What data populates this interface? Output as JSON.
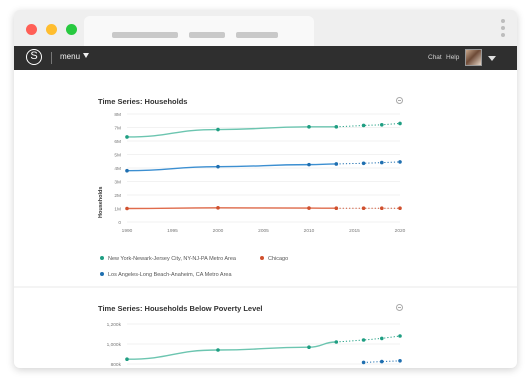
{
  "window": {
    "controls": [
      "close",
      "minimize",
      "maximize"
    ]
  },
  "appbar": {
    "logo_icon": "S",
    "menu_label": "menu",
    "chat_label": "Chat",
    "help_label": "Help"
  },
  "colors": {
    "teal": "#6cc5b0",
    "teal_dot": "#1f9e82",
    "blue": "#3c8fd1",
    "blue_dot": "#1f6fb0",
    "red": "#e06b4b",
    "red_dot": "#d0502e"
  },
  "chart_data": [
    {
      "type": "line",
      "title": "Time Series: Households",
      "ylabel": "Households",
      "xlabel": "",
      "x_ticks": [
        "1990",
        "1995",
        "2000",
        "2005",
        "2010",
        "2015",
        "2020"
      ],
      "y_ticks": [
        "8M",
        "7M",
        "6M",
        "5M",
        "4M",
        "3M",
        "2M",
        "1M",
        "0"
      ],
      "ylim": [
        0,
        8000000
      ],
      "xlim": [
        1990,
        2020
      ],
      "series": [
        {
          "name": "New York-Newark-Jersey City, NY-NJ-PA Metro Area",
          "color": "teal",
          "x": [
            1990,
            2000,
            2010,
            2013,
            2016,
            2018,
            2020
          ],
          "y": [
            6300000,
            6850000,
            7050000,
            7050000,
            7150000,
            7200000,
            7300000
          ]
        },
        {
          "name": "Chicago",
          "color": "red",
          "x": [
            1990,
            2000,
            2010,
            2013,
            2016,
            2018,
            2020
          ],
          "y": [
            1000000,
            1050000,
            1030000,
            1020000,
            1020000,
            1020000,
            1020000
          ]
        },
        {
          "name": "Los Angeles-Long Beach-Anaheim, CA Metro Area",
          "color": "blue",
          "x": [
            1990,
            2000,
            2010,
            2013,
            2016,
            2018,
            2020
          ],
          "y": [
            3800000,
            4100000,
            4250000,
            4300000,
            4350000,
            4400000,
            4450000
          ]
        }
      ],
      "legend": [
        "New York-Newark-Jersey City, NY-NJ-PA Metro Area",
        "Chicago",
        "Los Angeles-Long Beach-Anaheim, CA Metro Area"
      ]
    },
    {
      "type": "line",
      "title": "Time Series: Households Below Poverty Level",
      "ylabel": "",
      "xlabel": "",
      "y_ticks": [
        "1,200k",
        "1,000k",
        "800k"
      ],
      "ylim": [
        700000,
        1200000
      ],
      "xlim": [
        1990,
        2020
      ],
      "series": [
        {
          "name": "",
          "color": "teal",
          "x": [
            1990,
            2000,
            2010,
            2013,
            2016,
            2018,
            2020
          ],
          "y": [
            760000,
            875000,
            910000,
            975000,
            1000000,
            1020000,
            1050000
          ]
        },
        {
          "name": "",
          "color": "blue",
          "x": [
            2016,
            2018,
            2020
          ],
          "y": [
            720000,
            730000,
            740000
          ]
        }
      ]
    }
  ]
}
